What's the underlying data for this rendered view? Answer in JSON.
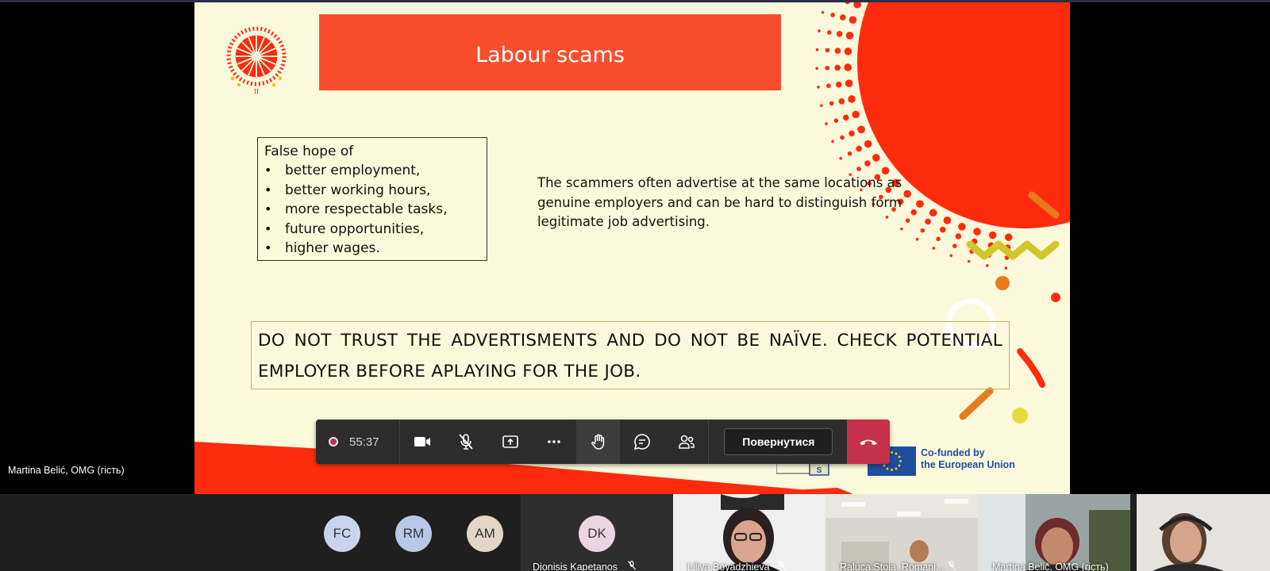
{
  "slide": {
    "title": "Labour scams",
    "hope_box": {
      "heading": "False hope of",
      "items": [
        "better employment,",
        "better working hours,",
        "more respectable tasks,",
        "future opportunities,",
        "higher wages."
      ]
    },
    "description": "The scammers often advertise at the same locations as genuine employers and can be hard to distinguish form legitimate job advertising.",
    "warning": "DO NOT TRUST THE ADVERTISMENTS AND DO NOT BE NAÏVE. CHECK POTENTIAL EMPLOYER BEFORE APLAYING FOR THE JOB.",
    "eu_label_line1": "Co-funded by",
    "eu_label_line2": "the European Union",
    "partner_letter": "S"
  },
  "presenter": {
    "name": "Martina Belić, OMG (гість)"
  },
  "toolbar": {
    "timer": "55:37",
    "leave_label": "Повернутися",
    "icons": [
      "record-icon",
      "camera-icon",
      "mic-off-icon",
      "share-icon",
      "more-icon",
      "raise-hand-icon",
      "chat-icon",
      "people-icon",
      "hangup-icon"
    ]
  },
  "participants": [
    {
      "initials": "FC",
      "color": "#c9d4ec"
    },
    {
      "initials": "RM",
      "color": "#b9c8e8"
    },
    {
      "initials": "AM",
      "color": "#e3d5c8"
    },
    {
      "initials": "DK",
      "color": "#ecd5e2",
      "name": "Dionisis Kapetanos"
    },
    {
      "name": "Liliya Boyadzhieva"
    },
    {
      "name": "Raluca Stoia_Romani..."
    },
    {
      "name": "Martina Belić, OMG (гість)"
    }
  ],
  "colors": {
    "accent_red": "#f94e2e",
    "slide_bg": "#fdf9dc",
    "hangup": "#c4314b",
    "eu_blue": "#1f4e9c"
  }
}
